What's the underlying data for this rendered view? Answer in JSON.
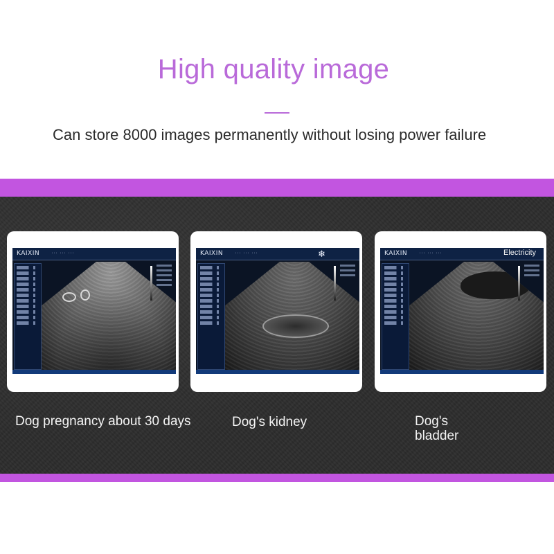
{
  "header": {
    "title": "High quality image",
    "subtitle": "Can store 8000 images permanently without losing power failure"
  },
  "colors": {
    "accent": "#c255e0",
    "title": "#b96ad9",
    "panel": "#2c2c2c"
  },
  "cards": [
    {
      "brand": "KAIXIN",
      "caption": "Dog pregnancy about 30 days",
      "icon": "ultrasound-image"
    },
    {
      "brand": "KAIXIN",
      "caption": "Dog's kidney",
      "icon": "snowflake-icon"
    },
    {
      "brand": "KAIXIN",
      "caption": "Dog's bladder",
      "overlay": "Electricity"
    }
  ]
}
